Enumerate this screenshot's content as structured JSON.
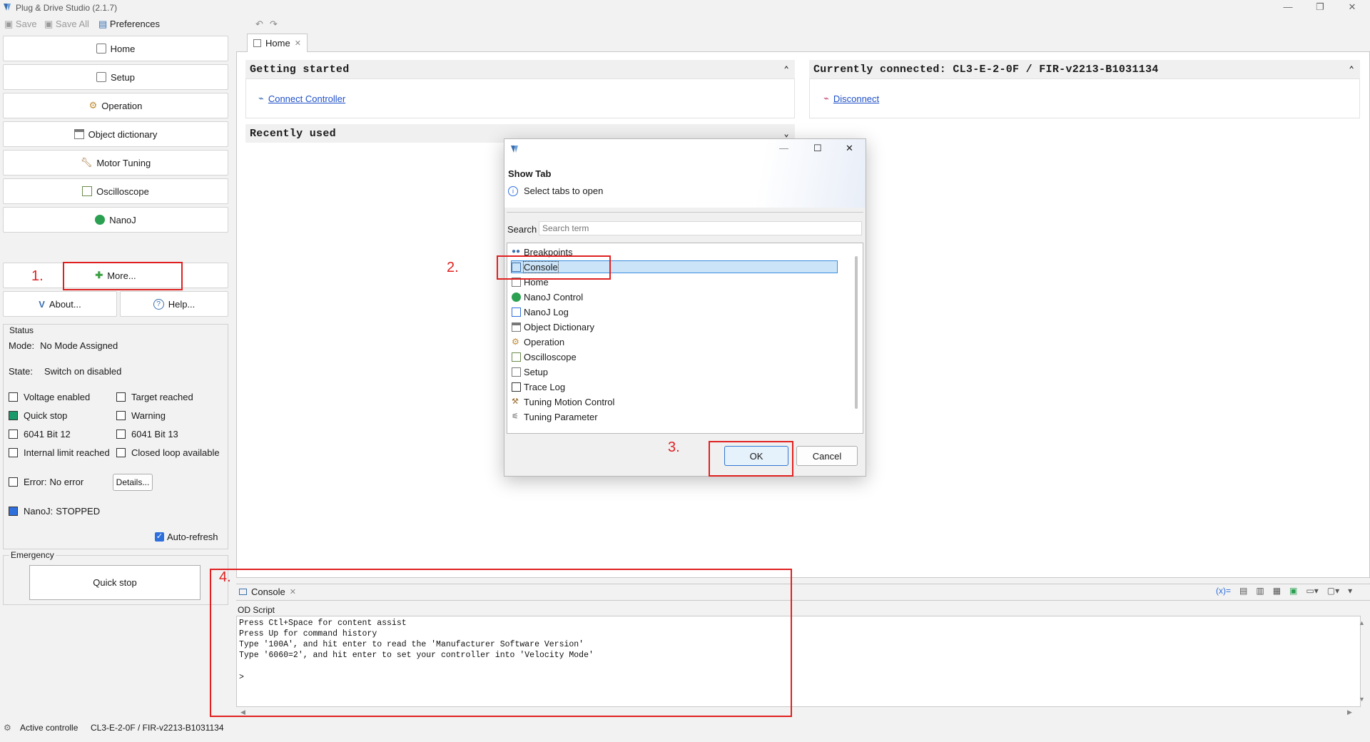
{
  "window": {
    "title": "Plug & Drive Studio (2.1.7)"
  },
  "toolbar": {
    "save": "Save",
    "save_all": "Save All",
    "preferences": "Preferences"
  },
  "nav": {
    "items": [
      {
        "label": "Home",
        "icon": "home-icon"
      },
      {
        "label": "Setup",
        "icon": "setup-icon"
      },
      {
        "label": "Operation",
        "icon": "gear-icon"
      },
      {
        "label": "Object dictionary",
        "icon": "table-icon"
      },
      {
        "label": "Motor Tuning",
        "icon": "wrench-icon"
      },
      {
        "label": "Oscilloscope",
        "icon": "oscilloscope-icon"
      },
      {
        "label": "NanoJ",
        "icon": "nanoj-icon"
      }
    ],
    "more": "More...",
    "about": "About...",
    "help": "Help..."
  },
  "status": {
    "title": "Status",
    "mode_label": "Mode:",
    "mode_value": "No Mode Assigned",
    "state_label": "State:",
    "state_value": "Switch on disabled",
    "flags": [
      {
        "label": "Voltage enabled",
        "on": false
      },
      {
        "label": "Target reached",
        "on": false
      },
      {
        "label": "Quick stop",
        "on": true
      },
      {
        "label": "Warning",
        "on": false
      },
      {
        "label": "6041 Bit 12",
        "on": false
      },
      {
        "label": "6041 Bit 13",
        "on": false
      },
      {
        "label": "Internal limit reached",
        "on": false
      },
      {
        "label": "Closed loop available",
        "on": false
      }
    ],
    "error_label": "Error:",
    "error_value": "No error",
    "details": "Details...",
    "nanoj_label": "NanoJ:",
    "nanoj_value": "STOPPED",
    "auto_refresh": "Auto-refresh"
  },
  "emergency": {
    "title": "Emergency",
    "quick_stop": "Quick stop"
  },
  "editor": {
    "tab": "Home",
    "getting_started": "Getting started",
    "connect": "Connect Controller",
    "connected_title": "Currently connected: CL3-E-2-0F / FIR-v2213-B1031134",
    "disconnect": "Disconnect",
    "recently_used": "Recently used"
  },
  "console": {
    "tab": "Console",
    "subtitle": "OD Script",
    "lines": [
      "Press Ctl+Space for content assist",
      "Press Up for command history",
      "Type '100A', and hit enter to read the 'Manufacturer Software Version'",
      "Type '6060=2', and hit enter to set your controller into 'Velocity Mode'"
    ],
    "prompt": ">"
  },
  "statusline": {
    "label": "Active controlle",
    "value": "CL3-E-2-0F / FIR-v2213-B1031134"
  },
  "dialog": {
    "heading": "Show Tab",
    "info": "Select tabs to open",
    "search_label": "Search",
    "search_placeholder": "Search term",
    "items": [
      "Breakpoints",
      "Console",
      "Home",
      "NanoJ Control",
      "NanoJ Log",
      "Object Dictionary",
      "Operation",
      "Oscilloscope",
      "Setup",
      "Trace Log",
      "Tuning Motion Control",
      "Tuning Parameter"
    ],
    "selected": "Console",
    "ok": "OK",
    "cancel": "Cancel"
  },
  "annotations": {
    "step1": "1.",
    "step2": "2.",
    "step3": "3.",
    "step4": "4."
  },
  "colors": {
    "annotation_red": "#e02020",
    "link_blue": "#1e50c8",
    "selection_blue": "#cce4f7",
    "quick_stop_green": "#1a9a6a",
    "nanoj_blue": "#2e6fdc"
  }
}
